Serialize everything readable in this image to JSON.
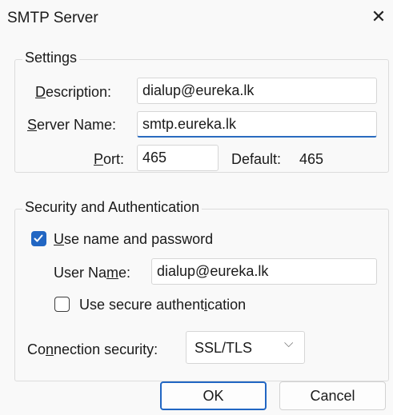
{
  "window": {
    "title": "SMTP Server",
    "close_glyph": "✕"
  },
  "settings": {
    "legend": "Settings",
    "description": {
      "label_u": "D",
      "label_rest": "escription:",
      "value": "dialup@eureka.lk"
    },
    "server_name": {
      "label_u": "S",
      "label_rest": "erver Name:",
      "value": "smtp.eureka.lk"
    },
    "port": {
      "label_u": "P",
      "label_rest": "ort:",
      "value": "465",
      "default_label": "Default:",
      "default_value": "465"
    }
  },
  "security": {
    "legend": "Security and Authentication",
    "use_name_password": {
      "label_u": "U",
      "label_rest": "se name and password",
      "checked": true
    },
    "user_name": {
      "label_pre": "User Na",
      "label_u": "m",
      "label_rest": "e:",
      "value": "dialup@eureka.lk"
    },
    "use_secure_auth": {
      "label_pre": "Use secure authent",
      "label_u": "i",
      "label_rest": "cation",
      "checked": false
    }
  },
  "connection": {
    "label_pre": "Co",
    "label_u": "n",
    "label_rest": "nection security:",
    "selected": "SSL/TLS",
    "chevron": "⌵"
  },
  "buttons": {
    "ok": "OK",
    "cancel": "Cancel"
  },
  "colors": {
    "accent": "#2166c3",
    "background": "#f9f9f9"
  }
}
